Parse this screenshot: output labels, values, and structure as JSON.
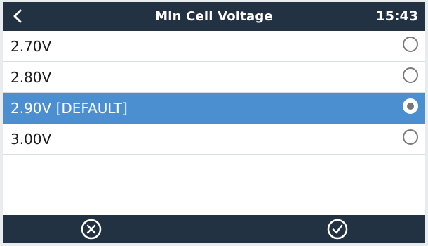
{
  "header": {
    "title": "Min Cell Voltage",
    "time": "15:43",
    "back_icon": "chevron-left-icon"
  },
  "options": [
    {
      "label": "2.70V",
      "selected": false
    },
    {
      "label": "2.80V",
      "selected": false
    },
    {
      "label": "2.90V [DEFAULT]",
      "selected": true
    },
    {
      "label": "3.00V",
      "selected": false
    }
  ],
  "footer": {
    "cancel_icon": "cancel-circle-icon",
    "confirm_icon": "check-circle-icon"
  },
  "colors": {
    "header_bg": "#233242",
    "selected_bg": "#4b8fd1",
    "divider": "#d7dde2"
  }
}
